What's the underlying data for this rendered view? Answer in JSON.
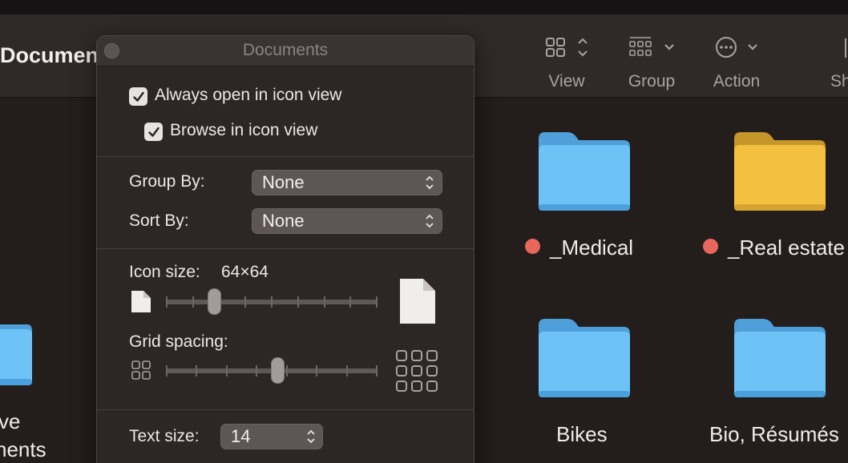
{
  "window": {
    "title": "Documents"
  },
  "toolbar": {
    "view_label": "View",
    "group_label": "Group",
    "action_label": "Action",
    "share_label": "Sh"
  },
  "files": [
    {
      "name": "_Medical",
      "color": "blue",
      "tag": "red"
    },
    {
      "name": "_Real estate",
      "color": "yellow",
      "tag": "red"
    },
    {
      "name": "Bikes",
      "color": "blue"
    },
    {
      "name": "Bio, Résumés",
      "color": "blue"
    }
  ],
  "partial_file": {
    "line1": "ve",
    "line2": "nents"
  },
  "colors": {
    "folder_blue": "#6ec3f6",
    "folder_yellow": "#f3c13f",
    "tag_red": "#e8675c"
  },
  "panel": {
    "title": "Documents",
    "always_open_label": "Always open in icon view",
    "always_open_checked": true,
    "browse_label": "Browse in icon view",
    "browse_checked": true,
    "group_by_label": "Group By:",
    "group_by_value": "None",
    "sort_by_label": "Sort By:",
    "sort_by_value": "None",
    "icon_size_label": "Icon size:",
    "icon_size_value": "64×64",
    "icon_size_fraction": 0.23,
    "grid_spacing_label": "Grid spacing:",
    "grid_spacing_fraction": 0.53,
    "text_size_label": "Text size:",
    "text_size_value": "14"
  }
}
